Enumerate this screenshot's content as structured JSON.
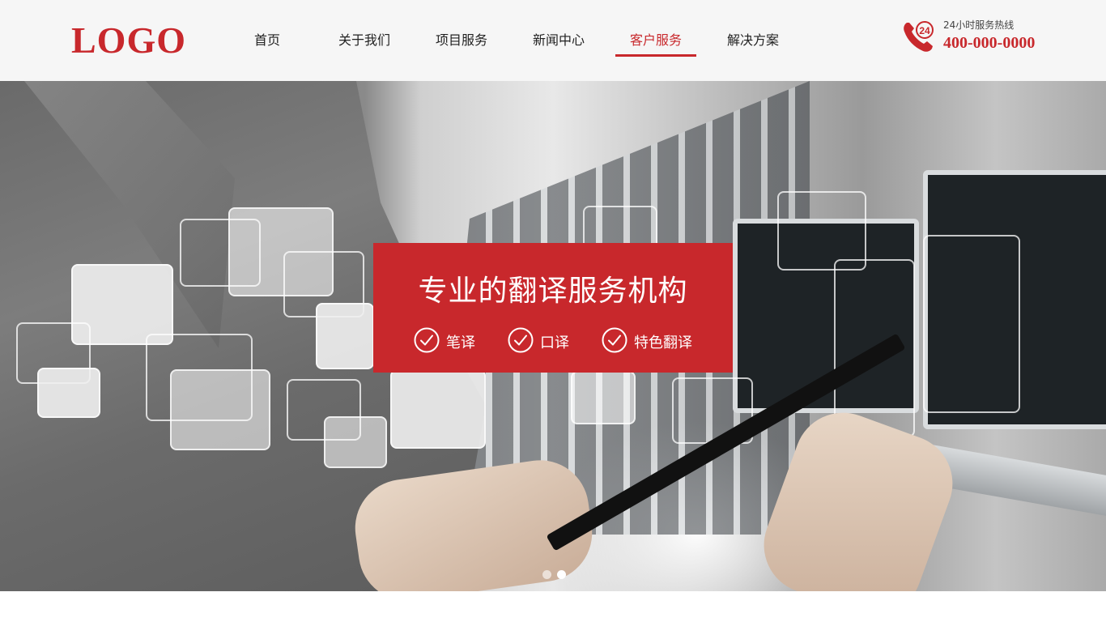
{
  "header": {
    "logo": "LOGO",
    "nav": [
      {
        "label": "首页",
        "active": false
      },
      {
        "label": "关于我们",
        "active": false
      },
      {
        "label": "项目服务",
        "active": false
      },
      {
        "label": "新闻中心",
        "active": false
      },
      {
        "label": "客户服务",
        "active": true
      },
      {
        "label": "解决方案",
        "active": false
      }
    ],
    "hotline": {
      "label": "24小时服务热线",
      "number": "400-000-0000",
      "icon": "phone-24-icon",
      "icon_text": "24"
    }
  },
  "banner": {
    "title": "专业的翻译服务机构",
    "features": [
      {
        "label": "笔译",
        "icon": "check-circle-icon"
      },
      {
        "label": "口译",
        "icon": "check-circle-icon"
      },
      {
        "label": "特色翻译",
        "icon": "check-circle-icon"
      }
    ],
    "slides": {
      "count": 2,
      "active_index": 1
    }
  },
  "colors": {
    "brand": "#c8282c",
    "header_bg": "#f6f6f6",
    "text": "#222222"
  }
}
